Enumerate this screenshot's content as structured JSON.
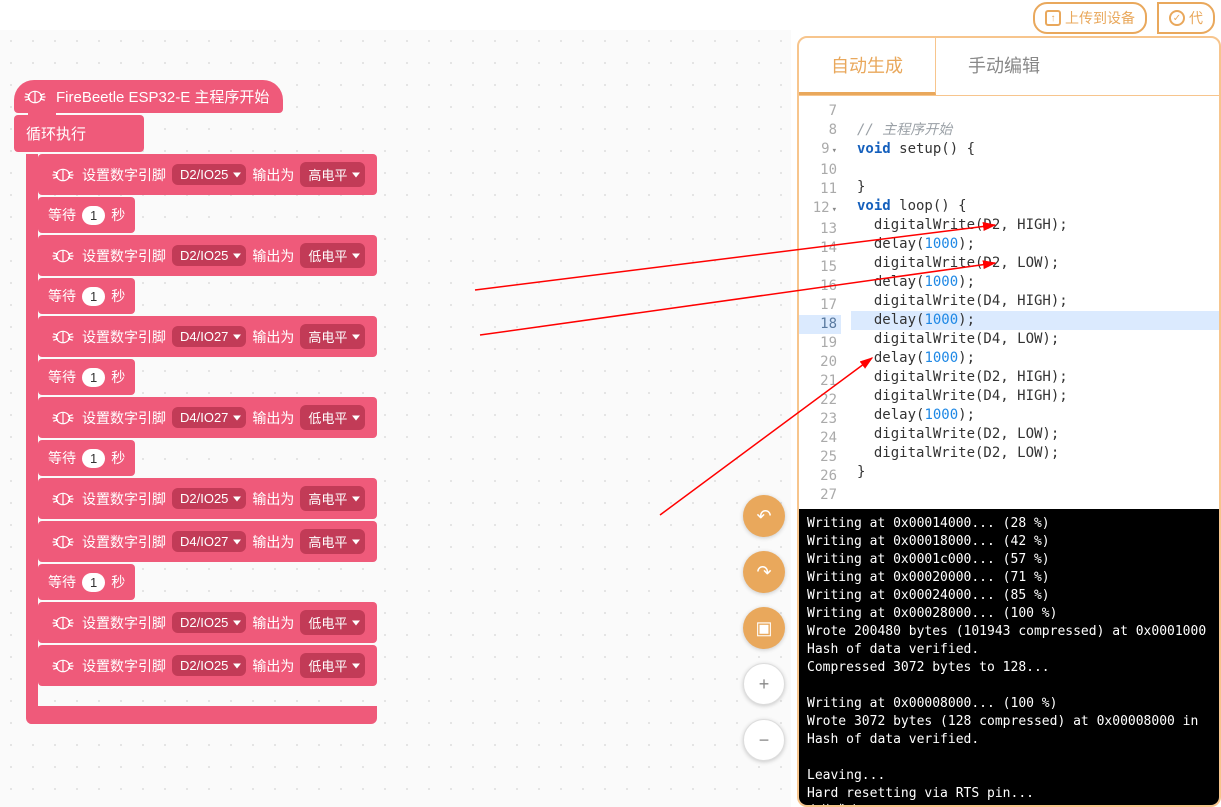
{
  "topbar": {
    "upload_label": "上传到设备",
    "right_partial_label": "代"
  },
  "blocks": {
    "hat_label": "FireBeetle ESP32-E 主程序开始",
    "loop_label": "循环执行",
    "set_pin_label": "设置数字引脚",
    "output_as_label": "输出为",
    "wait_label": "等待",
    "unit_sec": "秒",
    "pin_d2": "D2/IO25",
    "pin_d4": "D4/IO27",
    "level_high": "高电平",
    "level_low": "低电平",
    "wait_val": "1",
    "rows": [
      {
        "type": "pin",
        "pin": "pin_d2",
        "level": "level_high"
      },
      {
        "type": "wait"
      },
      {
        "type": "pin",
        "pin": "pin_d2",
        "level": "level_low"
      },
      {
        "type": "wait"
      },
      {
        "type": "pin",
        "pin": "pin_d4",
        "level": "level_high"
      },
      {
        "type": "wait"
      },
      {
        "type": "pin",
        "pin": "pin_d4",
        "level": "level_low"
      },
      {
        "type": "wait"
      },
      {
        "type": "pin",
        "pin": "pin_d2",
        "level": "level_high"
      },
      {
        "type": "pin",
        "pin": "pin_d4",
        "level": "level_high"
      },
      {
        "type": "wait"
      },
      {
        "type": "pin",
        "pin": "pin_d2",
        "level": "level_low"
      },
      {
        "type": "pin",
        "pin": "pin_d2",
        "level": "level_low"
      }
    ]
  },
  "tabs": {
    "auto": "自动生成",
    "manual": "手动编辑"
  },
  "code": {
    "lines": [
      {
        "n": 7,
        "text": ""
      },
      {
        "n": 8,
        "text": "// 主程序开始",
        "comment": true
      },
      {
        "n": 9,
        "text": "void setup() {",
        "fold": true,
        "kw": "void"
      },
      {
        "n": 10,
        "text": ""
      },
      {
        "n": 11,
        "text": "}"
      },
      {
        "n": 12,
        "text": "void loop() {",
        "fold": true,
        "kw": "void"
      },
      {
        "n": 13,
        "text": "  digitalWrite(D2, HIGH);"
      },
      {
        "n": 14,
        "text": "  delay(1000);",
        "num": "1000"
      },
      {
        "n": 15,
        "text": "  digitalWrite(D2, LOW);"
      },
      {
        "n": 16,
        "text": "  delay(1000);",
        "num": "1000"
      },
      {
        "n": 17,
        "text": "  digitalWrite(D4, HIGH);"
      },
      {
        "n": 18,
        "text": "  delay(1000);",
        "num": "1000",
        "hl": true
      },
      {
        "n": 19,
        "text": "  digitalWrite(D4, LOW);"
      },
      {
        "n": 20,
        "text": "  delay(1000);",
        "num": "1000"
      },
      {
        "n": 21,
        "text": "  digitalWrite(D2, HIGH);"
      },
      {
        "n": 22,
        "text": "  digitalWrite(D4, HIGH);"
      },
      {
        "n": 23,
        "text": "  delay(1000);",
        "num": "1000"
      },
      {
        "n": 24,
        "text": "  digitalWrite(D2, LOW);"
      },
      {
        "n": 25,
        "text": "  digitalWrite(D2, LOW);"
      },
      {
        "n": 26,
        "text": "}"
      },
      {
        "n": 27,
        "text": ""
      }
    ]
  },
  "console": {
    "lines": [
      "Writing at 0x00014000... (28 %)",
      "Writing at 0x00018000... (42 %)",
      "Writing at 0x0001c000... (57 %)",
      "Writing at 0x00020000... (71 %)",
      "Writing at 0x00024000... (85 %)",
      "Writing at 0x00028000... (100 %)",
      "Wrote 200480 bytes (101943 compressed) at 0x0001000",
      "Hash of data verified.",
      "Compressed 3072 bytes to 128...",
      "",
      "Writing at 0x00008000... (100 %)",
      "Wrote 3072 bytes (128 compressed) at 0x00008000 in",
      "Hash of data verified.",
      "",
      "Leaving...",
      "Hard resetting via RTS pin...",
      "上传成功"
    ]
  },
  "float": {
    "undo": "↶",
    "redo": "↷",
    "crop": "▣",
    "zoom_in": "+",
    "zoom_out": "−"
  },
  "colors": {
    "block_primary": "#ef5a7a",
    "block_shadow": "#c23b57",
    "accent_orange": "#e9a85c"
  }
}
